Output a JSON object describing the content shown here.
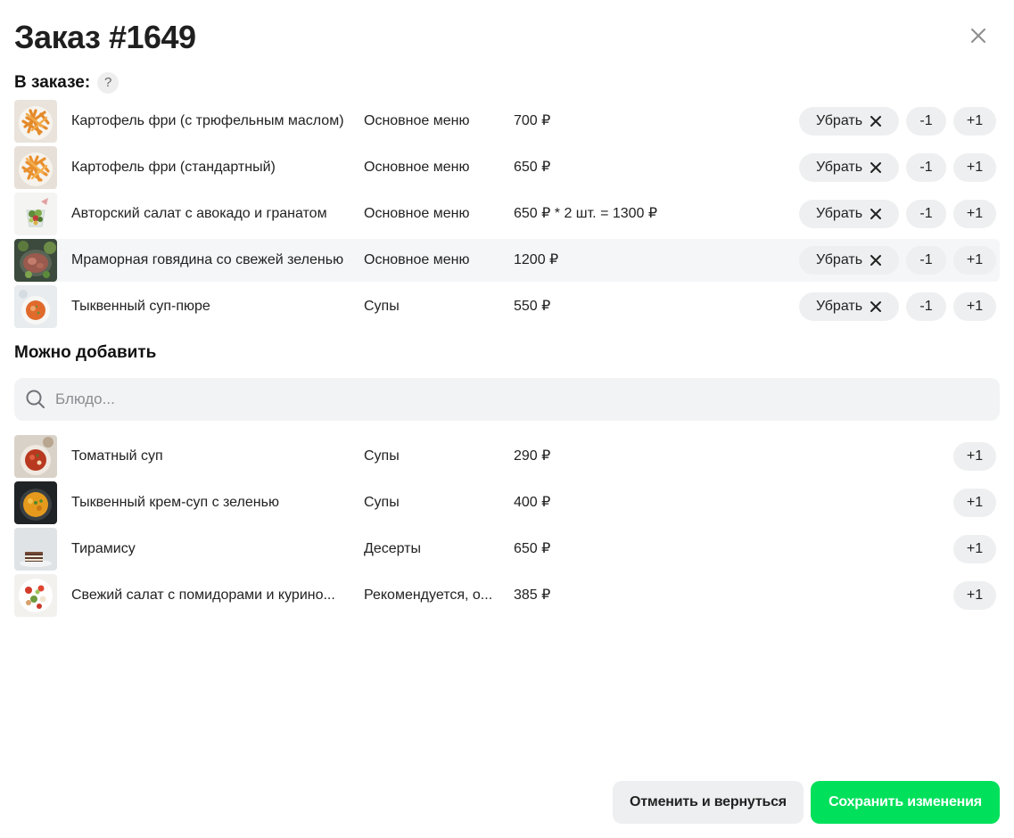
{
  "header": {
    "title": "Заказ #1649"
  },
  "in_order": {
    "label": "В заказе:",
    "help": "?",
    "remove_label": "Убрать",
    "minus_label": "-1",
    "plus_label": "+1",
    "items": [
      {
        "name": "Картофель фри (с трюфельным маслом)",
        "category": "Основное меню",
        "price": "700 ₽",
        "thumb": "fries-icon"
      },
      {
        "name": "Картофель фри (стандартный)",
        "category": "Основное меню",
        "price": "650 ₽",
        "thumb": "fries-icon"
      },
      {
        "name": "Авторский салат с авокадо и гранатом",
        "category": "Основное меню",
        "price": "650 ₽ * 2 шт. = 1300 ₽",
        "thumb": "salad-icon"
      },
      {
        "name": "Мраморная говядина со свежей зеленью",
        "category": "Основное меню",
        "price": "1200 ₽",
        "thumb": "steak-icon"
      },
      {
        "name": "Тыквенный суп-пюре",
        "category": "Супы",
        "price": "550 ₽",
        "thumb": "soup-icon"
      }
    ]
  },
  "can_add": {
    "label": "Можно добавить",
    "search_placeholder": "Блюдо...",
    "search_value": "",
    "plus_label": "+1",
    "items": [
      {
        "name": "Томатный суп",
        "category": "Супы",
        "price": "290 ₽",
        "thumb": "tomato-soup-icon"
      },
      {
        "name": "Тыквенный крем-суп с зеленью",
        "category": "Супы",
        "price": "400 ₽",
        "thumb": "pumpkin-soup-icon"
      },
      {
        "name": "Тирамису",
        "category": "Десерты",
        "price": "650 ₽",
        "thumb": "tiramisu-icon"
      },
      {
        "name": "Свежий салат с помидорами и курино...",
        "category": "Рекомендуется, о...",
        "price": "385 ₽",
        "thumb": "chicken-salad-icon"
      }
    ]
  },
  "footer": {
    "cancel_label": "Отменить и вернуться",
    "save_label": "Сохранить изменения"
  },
  "colors": {
    "accent": "#00e05a",
    "pill_bg": "#eeeff0",
    "highlight_row": "#f4f6f7"
  }
}
